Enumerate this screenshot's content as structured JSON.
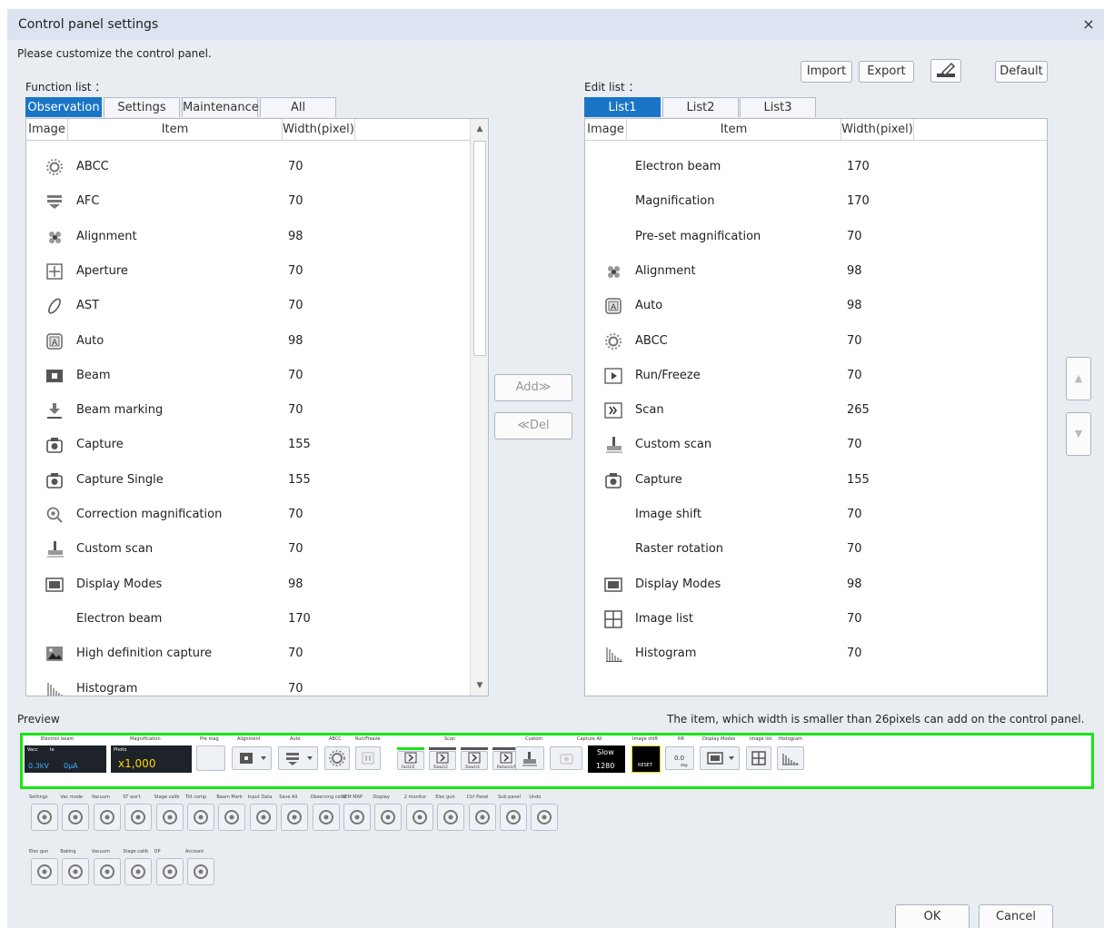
{
  "window": {
    "title": "Control panel settings",
    "close": "×"
  },
  "instructions": "Please customize the control panel.",
  "toolbar": {
    "import": "Import",
    "export": "Export",
    "default": "Default"
  },
  "function_list": {
    "label": "Function list ：",
    "tabs": [
      "Observation",
      "Settings",
      "Maintenance",
      "All"
    ],
    "active_tab": "Observation",
    "columns": [
      "Image",
      "Item",
      "Width(pixel)"
    ],
    "rows": [
      {
        "icon": "abcc-icon",
        "item": "ABCC",
        "width": "70"
      },
      {
        "icon": "afc-icon",
        "item": "AFC",
        "width": "70"
      },
      {
        "icon": "alignment-icon",
        "item": "Alignment",
        "width": "98"
      },
      {
        "icon": "aperture-icon",
        "item": "Aperture",
        "width": "70"
      },
      {
        "icon": "ast-icon",
        "item": "AST",
        "width": "70"
      },
      {
        "icon": "auto-icon",
        "item": "Auto",
        "width": "98"
      },
      {
        "icon": "beam-icon",
        "item": "Beam",
        "width": "70"
      },
      {
        "icon": "beam-marking-icon",
        "item": "Beam marking",
        "width": "70"
      },
      {
        "icon": "camera-icon",
        "item": "Capture",
        "width": "155"
      },
      {
        "icon": "camera-icon",
        "item": "Capture Single",
        "width": "155"
      },
      {
        "icon": "magnifier-icon",
        "item": "Correction magnification",
        "width": "70"
      },
      {
        "icon": "custom-scan-icon",
        "item": "Custom scan",
        "width": "70"
      },
      {
        "icon": "display-icon",
        "item": "Display Modes",
        "width": "98"
      },
      {
        "icon": "",
        "item": "Electron beam",
        "width": "170"
      },
      {
        "icon": "hd-capture-icon",
        "item": "High definition capture",
        "width": "70"
      },
      {
        "icon": "histogram-icon",
        "item": "Histogram",
        "width": "70"
      }
    ]
  },
  "edit_list": {
    "label": "Edit list ：",
    "tabs": [
      "List1",
      "List2",
      "List3"
    ],
    "active_tab": "List1",
    "columns": [
      "Image",
      "Item",
      "Width(pixel)"
    ],
    "rows": [
      {
        "icon": "",
        "item": "Electron beam",
        "width": "170"
      },
      {
        "icon": "",
        "item": "Magnification",
        "width": "170"
      },
      {
        "icon": "",
        "item": "Pre-set magnification",
        "width": "70"
      },
      {
        "icon": "alignment-icon",
        "item": "Alignment",
        "width": "98"
      },
      {
        "icon": "auto-icon",
        "item": "Auto",
        "width": "98"
      },
      {
        "icon": "abcc-icon",
        "item": "ABCC",
        "width": "70"
      },
      {
        "icon": "run-freeze-icon",
        "item": "Run/Freeze",
        "width": "70"
      },
      {
        "icon": "scan-icon",
        "item": "Scan",
        "width": "265"
      },
      {
        "icon": "custom-scan-icon",
        "item": "Custom scan",
        "width": "70"
      },
      {
        "icon": "camera-icon",
        "item": "Capture",
        "width": "155"
      },
      {
        "icon": "",
        "item": "Image shift",
        "width": "70"
      },
      {
        "icon": "",
        "item": "Raster rotation",
        "width": "70"
      },
      {
        "icon": "display-icon",
        "item": "Display Modes",
        "width": "98"
      },
      {
        "icon": "image-list-icon",
        "item": "Image list",
        "width": "70"
      },
      {
        "icon": "histogram-icon",
        "item": "Histogram",
        "width": "70"
      }
    ]
  },
  "buttons": {
    "add": "Add≫",
    "del": "≪Del",
    "ok": "OK",
    "cancel": "Cancel"
  },
  "preview": {
    "label": "Preview",
    "note": "The item, which width is smaller than 26pixels can add on the control panel.",
    "labels": [
      "Electron beam",
      "Magnification",
      "Pre mag",
      "Alignment",
      "Auto",
      "ABCC",
      "Run/Freeze",
      "Scan",
      "Custom",
      "Capture All",
      "Image shift",
      "RR",
      "Display Modes",
      "Image list",
      "Histogram"
    ],
    "vacc_label": "Vacc",
    "ie_label": "Ie",
    "vacc_value": "0.3kV",
    "ie_value": "0μA",
    "photo_label": "Photo",
    "mag_value": "x1,000",
    "scan_labels": [
      "Fast1/2",
      "Slow1/2",
      "Slow1/4",
      "Reduce1/N"
    ],
    "capture_mode": "Slow",
    "capture_px": "1280",
    "reset": "RESET",
    "rr_value": "0.0",
    "rr_unit": "deg"
  },
  "sub_row1": {
    "labels": [
      "Settings",
      "Vac mode",
      "Vacuum",
      "ST ass't",
      "Stage calib",
      "Tilt comp",
      "Beam Mark",
      "Input Data",
      "Save All",
      "Observing cond",
      "SEM MAP",
      "Display",
      "2 monitor",
      "Elec gun",
      "Ctrl Panel",
      "Sub panel",
      "Undo"
    ]
  },
  "sub_row2": {
    "labels": [
      "Elec gun",
      "Baking",
      "Vacuum",
      "Stage calib",
      "DP",
      "Account"
    ]
  }
}
